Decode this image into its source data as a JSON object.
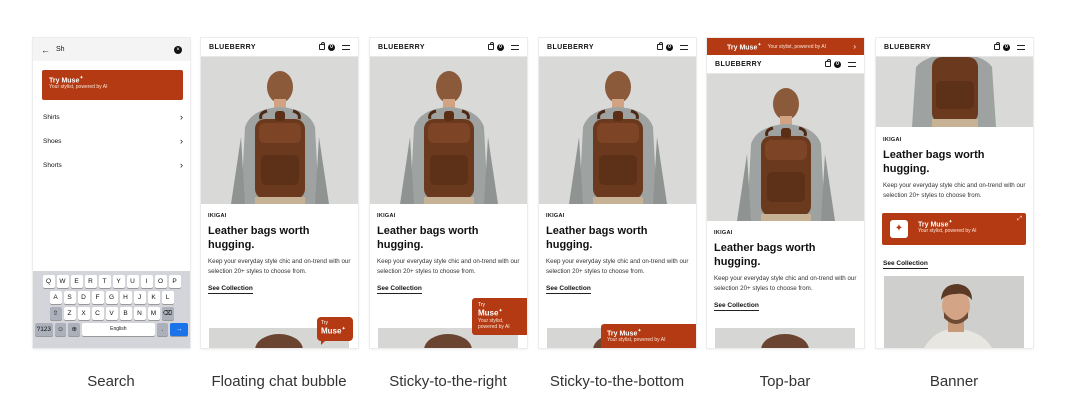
{
  "brand": "BLUEBERRY",
  "cart_count": "0",
  "product": {
    "eyebrow": "IKIGAI",
    "headline": "Leather bags worth hugging.",
    "body": "Keep your everyday style chic and on-trend with our selection 20+ styles to choose from.",
    "cta": "See Collection"
  },
  "muse": {
    "try_muse": "Try Muse",
    "try": "Try",
    "muse": "Muse",
    "tagline": "Your stylist, powered by AI"
  },
  "search": {
    "query": "Sh",
    "suggestions": [
      "Shirts",
      "Shoes",
      "Shorts"
    ]
  },
  "keyboard": {
    "row1": [
      "Q",
      "W",
      "E",
      "R",
      "T",
      "Y",
      "U",
      "I",
      "O",
      "P"
    ],
    "row2": [
      "A",
      "S",
      "D",
      "F",
      "G",
      "H",
      "J",
      "K",
      "L"
    ],
    "row3": [
      "Z",
      "X",
      "C",
      "V",
      "B",
      "N",
      "M"
    ],
    "num_key": "?123",
    "space_label": "English",
    "period": "."
  },
  "captions": [
    "Search",
    "Floating chat bubble",
    "Sticky-to-the-right",
    "Sticky-to-the-bottom",
    "Top-bar",
    "Banner"
  ],
  "colors": {
    "accent": "#b33a12",
    "hero_bg": "#d8d8d6"
  },
  "icons": [
    "back-arrow-icon",
    "clear-icon",
    "chevron-right-icon",
    "bag-icon",
    "menu-icon",
    "sparkle-icon",
    "expand-icon"
  ]
}
